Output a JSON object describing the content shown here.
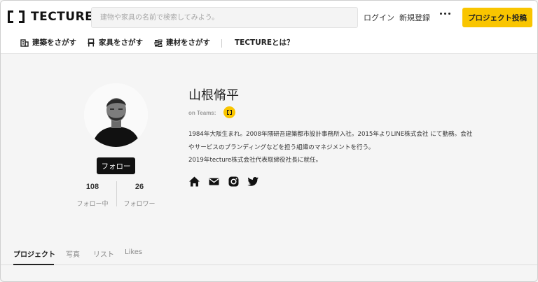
{
  "header": {
    "logo_text": "TECTURE",
    "search_placeholder": "建物や家具の名前で検索してみよう。",
    "login_label": "ログイン",
    "signup_label": "新規登録",
    "post_button_label": "プロジェクト投稿",
    "more_icon": "more-dots-icon"
  },
  "nav": {
    "items": [
      {
        "label": "建築をさがす",
        "icon": "building-icon"
      },
      {
        "label": "家具をさがす",
        "icon": "chair-icon"
      },
      {
        "label": "建材をさがす",
        "icon": "bricks-icon"
      },
      {
        "label": "TECTUREとは？",
        "icon": ""
      }
    ]
  },
  "profile": {
    "name": "山根脩平",
    "teams_label": "on Teams:",
    "follow_label": "フォロー",
    "following_count": "108",
    "following_label": "フォロー中",
    "followers_count": "26",
    "followers_label": "フォロワー",
    "bio_lines": [
      "1984年大阪生まれ。2008年隈研吾建築都市設計事務所入社。2015年よりLINE株式会社 にて勤務。会社",
      "やサービスのブランディングなどを担う組織のマネジメントを行う。",
      "2019年tecture株式会社代表取締役社長に就任。"
    ],
    "social_icons": [
      "home-icon",
      "mail-icon",
      "instagram-icon",
      "twitter-icon"
    ]
  },
  "tabs": [
    {
      "label": "プロジェクト",
      "active": true
    },
    {
      "label": "写真",
      "active": false
    },
    {
      "label": "リスト",
      "active": false
    },
    {
      "label": "Likes",
      "active": false
    }
  ],
  "colors": {
    "accent": "#f9c500",
    "background": "#f5f5f5",
    "text": "#222222"
  }
}
